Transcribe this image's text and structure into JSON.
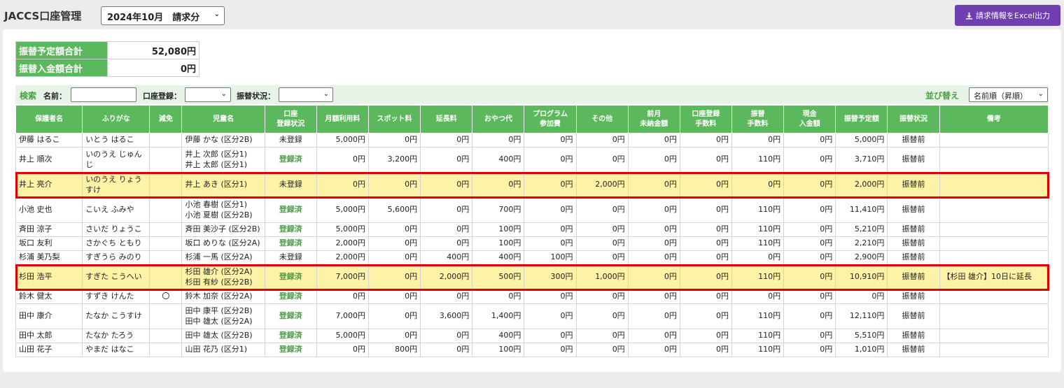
{
  "header": {
    "title": "JACCS口座管理",
    "period": "2024年10月　請求分",
    "excel_button": "請求情報をExcel出力",
    "excel_icon": "download-icon"
  },
  "summary": [
    {
      "label": "振替予定額合計",
      "value": "52,080円"
    },
    {
      "label": "振替入金額合計",
      "value": "0円"
    }
  ],
  "filters": {
    "search_label": "検索",
    "name_label": "名前：",
    "name_value": "",
    "account_label": "口座登録：",
    "account_value": "",
    "transfer_label": "振替状況：",
    "transfer_value": "",
    "sort_label": "並び替え",
    "sort_value": "名前順（昇順）"
  },
  "columns": [
    "保護者名",
    "ふりがな",
    "減免",
    "児童名",
    "口座\n登録状況",
    "月額利用料",
    "スポット料",
    "延長料",
    "おやつ代",
    "プログラム\n参加費",
    "その他",
    "前月\n未納金額",
    "口座登録\n手数料",
    "振替\n手数料",
    "現金\n入金額",
    "振替予定額",
    "振替状況",
    "備考"
  ],
  "rows": [
    {
      "cells": [
        "伊藤 はるこ",
        "いとう はるこ",
        "",
        "伊藤 かな (区分2B)",
        "未登録",
        "5,000円",
        "0円",
        "0円",
        "0円",
        "0円",
        "0円",
        "0円",
        "0円",
        "0円",
        "0円",
        "5,000円",
        "振替前",
        ""
      ],
      "tall": false,
      "hl": false
    },
    {
      "cells": [
        "井上 順次",
        "いのうえ じゅんじ",
        "",
        "井上 次郎 (区分1)\n井上 太郎 (区分1)",
        "登録済",
        "0円",
        "3,200円",
        "0円",
        "400円",
        "0円",
        "0円",
        "0円",
        "0円",
        "110円",
        "0円",
        "3,710円",
        "振替前",
        ""
      ],
      "tall": true,
      "hl": false
    },
    {
      "cells": [
        "井上 亮介",
        "いのうえ りょうすけ",
        "",
        "井上 あき (区分1)",
        "未登録",
        "0円",
        "0円",
        "0円",
        "0円",
        "0円",
        "2,000円",
        "0円",
        "0円",
        "0円",
        "0円",
        "2,000円",
        "振替前",
        ""
      ],
      "tall": true,
      "hl": true
    },
    {
      "cells": [
        "小池 史也",
        "こいえ ふみや",
        "",
        "小池 春樹 (区分1)\n小池 夏樹 (区分2B)",
        "登録済",
        "5,000円",
        "5,600円",
        "0円",
        "700円",
        "0円",
        "0円",
        "0円",
        "0円",
        "110円",
        "0円",
        "11,410円",
        "振替前",
        ""
      ],
      "tall": true,
      "hl": false
    },
    {
      "cells": [
        "斉田 涼子",
        "さいだ りょうこ",
        "",
        "斉田 美沙子 (区分2B)",
        "登録済",
        "5,000円",
        "0円",
        "0円",
        "100円",
        "0円",
        "0円",
        "0円",
        "0円",
        "110円",
        "0円",
        "5,210円",
        "振替前",
        ""
      ],
      "tall": false,
      "hl": false
    },
    {
      "cells": [
        "坂口 友利",
        "さかぐち ともり",
        "",
        "坂口 めりな (区分2A)",
        "登録済",
        "2,000円",
        "0円",
        "0円",
        "100円",
        "0円",
        "0円",
        "0円",
        "0円",
        "110円",
        "0円",
        "2,210円",
        "振替前",
        ""
      ],
      "tall": false,
      "hl": false
    },
    {
      "cells": [
        "杉浦 美乃梨",
        "すぎうら みのり",
        "",
        "杉浦 一馬 (区分2A)",
        "未登録",
        "2,000円",
        "0円",
        "400円",
        "400円",
        "100円",
        "0円",
        "0円",
        "0円",
        "0円",
        "0円",
        "2,900円",
        "振替前",
        ""
      ],
      "tall": false,
      "hl": false
    },
    {
      "cells": [
        "杉田 浩平",
        "すぎた こうへい",
        "",
        "杉田 雄介 (区分2A)\n杉田 有紗 (区分2B)",
        "登録済",
        "7,000円",
        "0円",
        "2,000円",
        "500円",
        "300円",
        "1,000円",
        "0円",
        "0円",
        "110円",
        "0円",
        "10,910円",
        "振替前",
        "【杉田 雄介】10日に延長"
      ],
      "tall": true,
      "hl": true
    },
    {
      "cells": [
        "鈴木 健太",
        "すずき けんた",
        "〇",
        "鈴木 加奈 (区分2A)",
        "登録済",
        "0円",
        "0円",
        "0円",
        "0円",
        "0円",
        "0円",
        "0円",
        "0円",
        "0円",
        "0円",
        "0円",
        "振替前",
        ""
      ],
      "tall": false,
      "hl": false
    },
    {
      "cells": [
        "田中 康介",
        "たなか こうすけ",
        "",
        "田中 康平 (区分2B)\n田中 雄太 (区分2A)",
        "登録済",
        "7,000円",
        "0円",
        "3,600円",
        "1,400円",
        "0円",
        "0円",
        "0円",
        "0円",
        "110円",
        "0円",
        "12,110円",
        "振替前",
        ""
      ],
      "tall": true,
      "hl": false
    },
    {
      "cells": [
        "田中 太郎",
        "たなか たろう",
        "",
        "田中 雄太 (区分2B)",
        "登録済",
        "5,000円",
        "0円",
        "0円",
        "400円",
        "0円",
        "0円",
        "0円",
        "0円",
        "110円",
        "0円",
        "5,510円",
        "振替前",
        ""
      ],
      "tall": false,
      "hl": false
    },
    {
      "cells": [
        "山田 花子",
        "やまだ はなこ",
        "",
        "山田 花乃 (区分1)",
        "登録済",
        "0円",
        "800円",
        "0円",
        "100円",
        "0円",
        "0円",
        "0円",
        "0円",
        "110円",
        "0円",
        "1,010円",
        "振替前",
        ""
      ],
      "tall": false,
      "hl": false
    }
  ]
}
